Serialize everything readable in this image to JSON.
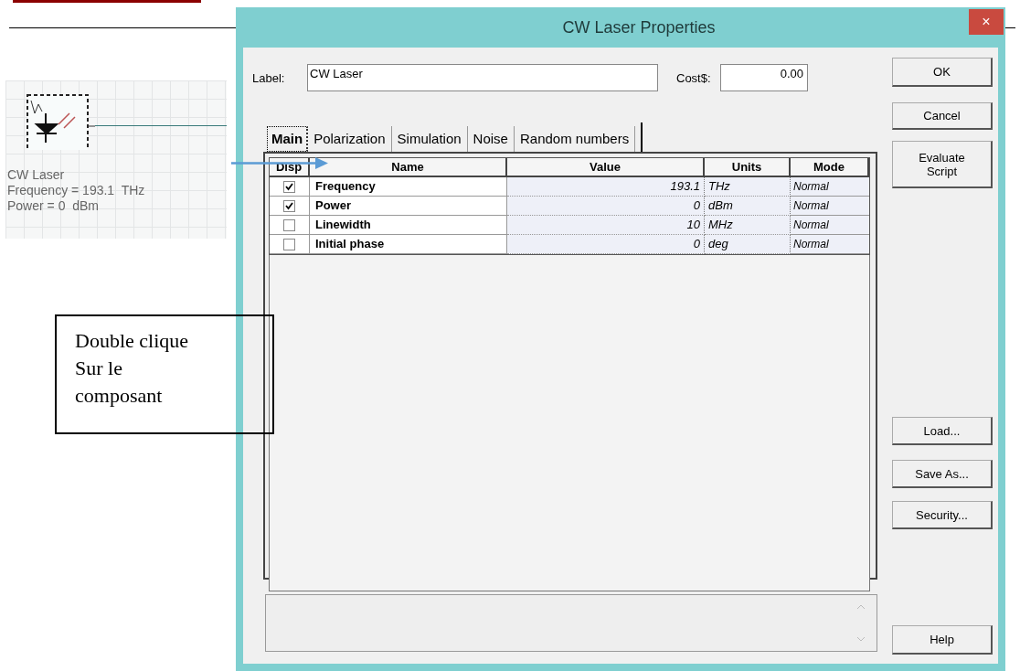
{
  "component": {
    "label": "CW Laser",
    "parameters": [
      "Frequency = 193.1  THz",
      "Power = 0  dBm"
    ]
  },
  "callout": {
    "lines": [
      "Double clique",
      "Sur le",
      "composant"
    ]
  },
  "dialog": {
    "title": "CW Laser Properties",
    "close": "×",
    "label_field": {
      "label": "Label:",
      "value": "CW Laser"
    },
    "cost_field": {
      "label": "Cost$:",
      "value": "0.00"
    },
    "tabs": [
      {
        "label": "Main",
        "selected": true
      },
      {
        "label": "Polarization",
        "selected": false
      },
      {
        "label": "Simulation",
        "selected": false
      },
      {
        "label": "Noise",
        "selected": false
      },
      {
        "label": "Random numbers",
        "selected": false
      }
    ],
    "table": {
      "columns": [
        "Disp",
        "Name",
        "Value",
        "Units",
        "Mode"
      ],
      "rows": [
        {
          "checked": true,
          "name": "Frequency",
          "value": "193.1",
          "units": "THz",
          "mode": "Normal"
        },
        {
          "checked": true,
          "name": "Power",
          "value": "0",
          "units": "dBm",
          "mode": "Normal"
        },
        {
          "checked": false,
          "name": "Linewidth",
          "value": "10",
          "units": "MHz",
          "mode": "Normal"
        },
        {
          "checked": false,
          "name": "Initial phase",
          "value": "0",
          "units": "deg",
          "mode": "Normal"
        }
      ]
    },
    "top_buttons": [
      "OK",
      "Cancel",
      "Evaluate Script"
    ],
    "middle_buttons": [
      "Load...",
      "Save As...",
      "Security..."
    ],
    "help_button": "Help"
  }
}
